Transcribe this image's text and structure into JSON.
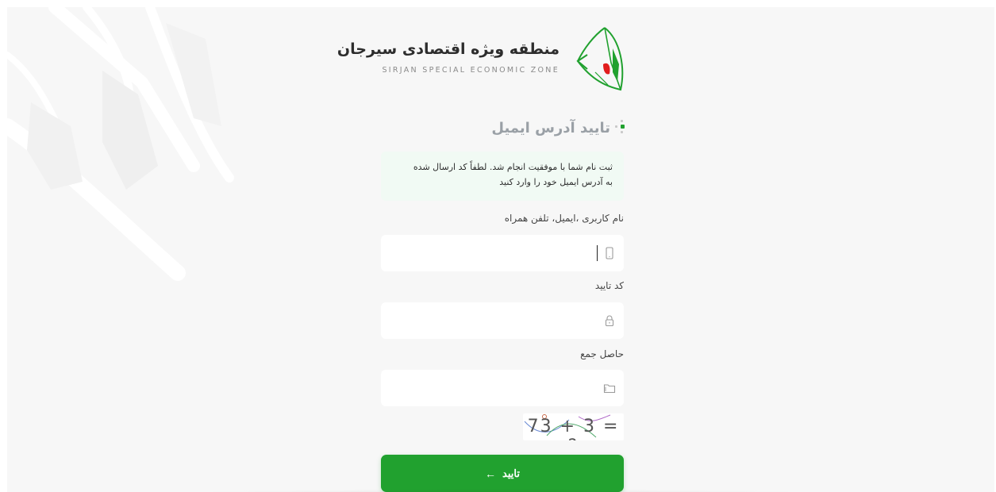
{
  "brand": {
    "name_fa": "منطقه ویژه اقتصادی سیرجان",
    "name_en": "SIRJAN SPECIAL ECONOMIC ZONE",
    "logo_icon": "sirjan-sez-logo",
    "accent_color": "#21a12f",
    "logo_red": "#e11d1d"
  },
  "page": {
    "title": "تایید آدرس ایمیل",
    "info_line1": "ثبت نام شما با موفقیت انجام شد. لطفاً کد ارسال شده",
    "info_line2": "به آدرس ایمیل خود را وارد کنید"
  },
  "form": {
    "username_label": "نام کاربری ،ایمیل، تلفن همراه",
    "username_value": "",
    "username_icon": "mobile-phone-icon",
    "code_label": "کد تایید",
    "code_value": "",
    "code_icon": "lock-icon",
    "sum_label": "حاصل جمع",
    "sum_value": "",
    "sum_icon": "folder-icon",
    "captcha_text": "73 + 3 = ?",
    "submit_label": "تایید",
    "submit_icon": "arrow-left-icon"
  }
}
